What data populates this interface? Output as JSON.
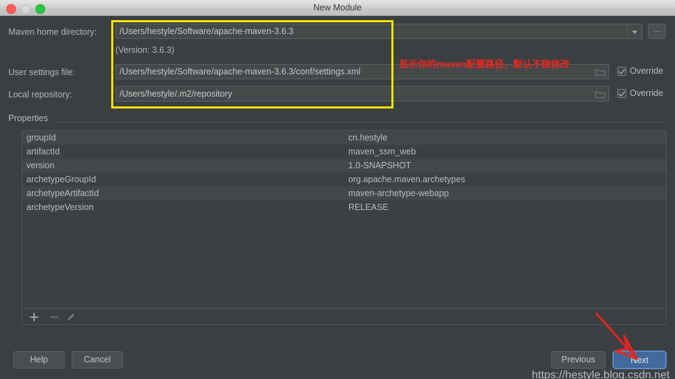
{
  "window": {
    "title": "New Module",
    "controls": {
      "close": "close-button",
      "minimize": "minimize-button",
      "maximize": "maximize-button"
    }
  },
  "form": {
    "maven_home": {
      "label": "Maven home directory:",
      "value": "/Users/hestyle/Software/apache-maven-3.6.3",
      "version_note": "(Version: 3.6.3)",
      "dropdown_icon": "chevron-down-icon",
      "browse_label": "..."
    },
    "user_settings": {
      "label": "User settings file:",
      "value": "/Users/hestyle/Software/apache-maven-3.6.3/conf/settings.xml",
      "folder_icon": "folder-icon",
      "override_label": "Override",
      "override_checked": true
    },
    "local_repository": {
      "label": "Local repository:",
      "value": "/Users/hestyle/.m2/repository",
      "folder_icon": "folder-icon",
      "override_label": "Override",
      "override_checked": true
    }
  },
  "annotations": {
    "chinese_note": "显示你的maven配置路径，默认不做修改",
    "highlight_color": "#ffe400",
    "note_color": "#e8271f",
    "arrow_color": "#e8271f"
  },
  "properties": {
    "section_title": "Properties",
    "rows": [
      {
        "key": "groupId",
        "value": "cn.hestyle"
      },
      {
        "key": "artifactId",
        "value": "maven_ssm_web"
      },
      {
        "key": "version",
        "value": "1.0-SNAPSHOT"
      },
      {
        "key": "archetypeGroupId",
        "value": "org.apache.maven.archetypes"
      },
      {
        "key": "archetypeArtifactId",
        "value": "maven-archetype-webapp"
      },
      {
        "key": "archetypeVersion",
        "value": "RELEASE"
      }
    ],
    "toolbar": {
      "add_icon": "plus-icon",
      "remove_icon": "minus-icon",
      "edit_icon": "pencil-icon"
    }
  },
  "footer": {
    "help": "Help",
    "cancel": "Cancel",
    "previous": "Previous",
    "next": "Next",
    "next_accent_color": "#41699c"
  },
  "watermark": "https://hestyle.blog.csdn.net"
}
